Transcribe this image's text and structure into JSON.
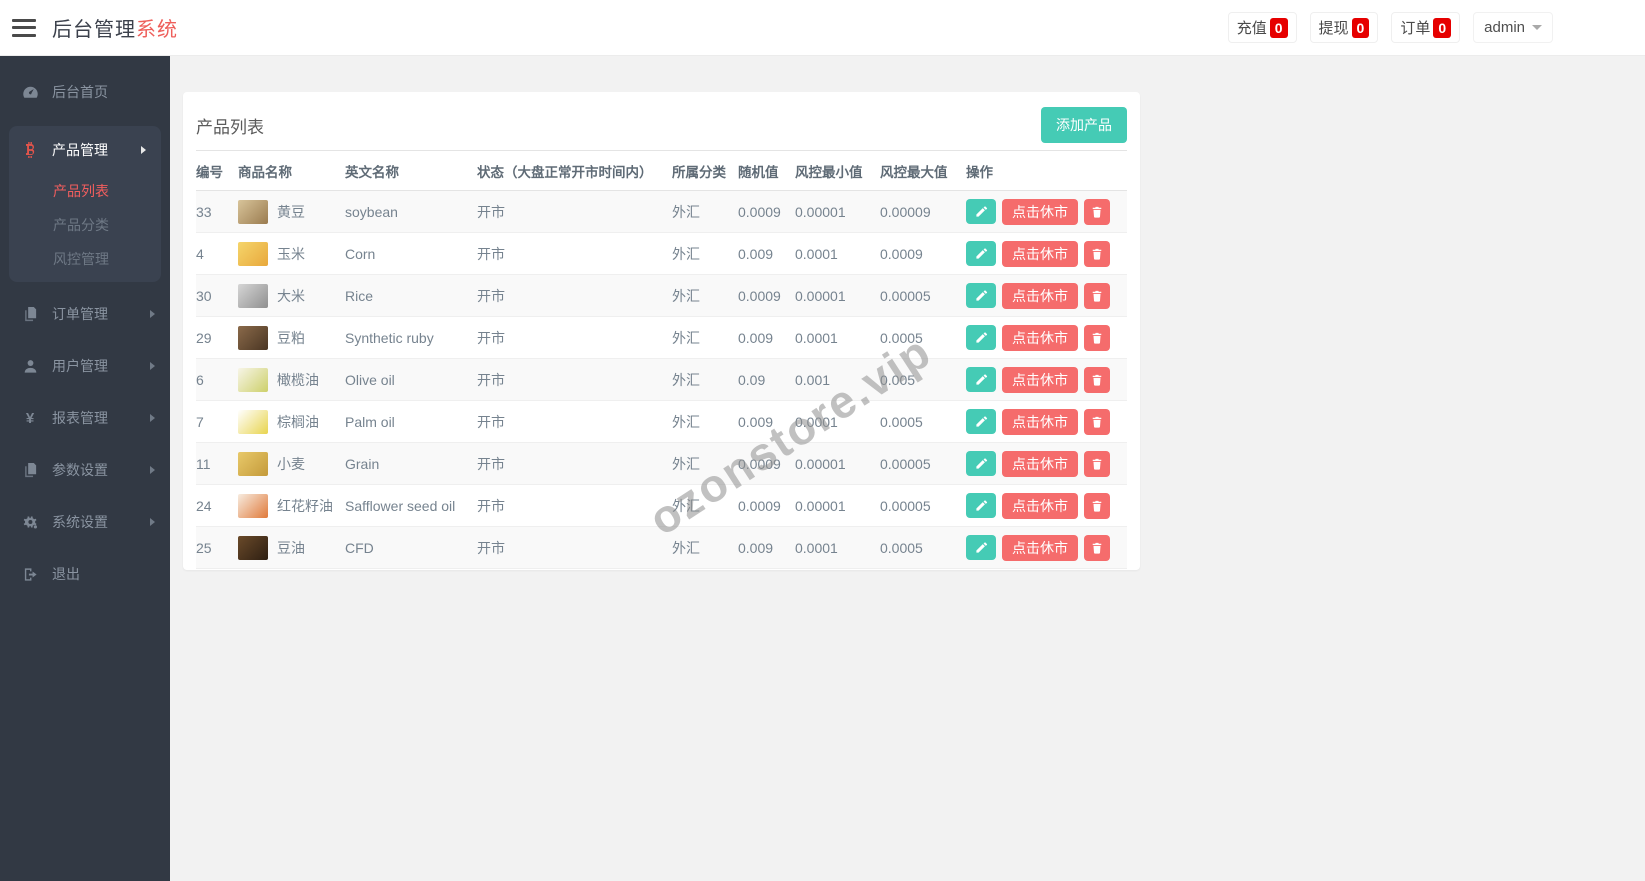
{
  "brand": {
    "prefix": "后台管理",
    "suffix": "系统"
  },
  "topbar": {
    "stats": [
      {
        "label": "充值",
        "count": "0"
      },
      {
        "label": "提现",
        "count": "0"
      },
      {
        "label": "订单",
        "count": "0"
      }
    ],
    "user": "admin"
  },
  "sidebar": {
    "items": [
      {
        "label": "后台首页",
        "icon": "dashboard-icon"
      },
      {
        "label": "产品管理",
        "icon": "bitcoin-icon",
        "expanded": true,
        "children": [
          "产品列表",
          "产品分类",
          "风控管理"
        ],
        "active_child": "产品列表"
      },
      {
        "label": "订单管理",
        "icon": "orders-icon"
      },
      {
        "label": "用户管理",
        "icon": "user-icon"
      },
      {
        "label": "报表管理",
        "icon": "yen-icon"
      },
      {
        "label": "参数设置",
        "icon": "params-icon"
      },
      {
        "label": "系统设置",
        "icon": "gear-icon"
      },
      {
        "label": "退出",
        "icon": "logout-icon"
      }
    ]
  },
  "main": {
    "card_title": "产品列表",
    "add_button": "添加产品",
    "watermark": "ozonstore.vip",
    "table": {
      "headers": [
        "编号",
        "商品名称",
        "英文名称",
        "状态（大盘正常开市时间内）",
        "所属分类",
        "随机值",
        "风控最小值",
        "风控最大值",
        "操作"
      ],
      "row_action_label": "点击休市",
      "rows": [
        {
          "id": "33",
          "name": "黄豆",
          "en": "soybean",
          "status": "开市",
          "category": "外汇",
          "random": "0.0009",
          "risk_min": "0.00001",
          "risk_max": "0.00009",
          "thumb": [
            "#d8c49a",
            "#9a7b4f"
          ]
        },
        {
          "id": "4",
          "name": "玉米",
          "en": "Corn",
          "status": "开市",
          "category": "外汇",
          "random": "0.009",
          "risk_min": "0.0001",
          "risk_max": "0.0009",
          "thumb": [
            "#f5d56b",
            "#e8a83c"
          ]
        },
        {
          "id": "30",
          "name": "大米",
          "en": "Rice",
          "status": "开市",
          "category": "外汇",
          "random": "0.0009",
          "risk_min": "0.00001",
          "risk_max": "0.00005",
          "thumb": [
            "#d6d6d6",
            "#8f8f8f"
          ]
        },
        {
          "id": "29",
          "name": "豆粕",
          "en": "Synthetic ruby",
          "status": "开市",
          "category": "外汇",
          "random": "0.009",
          "risk_min": "0.0001",
          "risk_max": "0.0005",
          "thumb": [
            "#8a6a4a",
            "#4a3523"
          ]
        },
        {
          "id": "6",
          "name": "橄榄油",
          "en": "Olive oil",
          "status": "开市",
          "category": "外汇",
          "random": "0.09",
          "risk_min": "0.001",
          "risk_max": "0.005",
          "thumb": [
            "#f7f5e8",
            "#cdd06a"
          ]
        },
        {
          "id": "7",
          "name": "棕榈油",
          "en": "Palm oil",
          "status": "开市",
          "category": "外汇",
          "random": "0.009",
          "risk_min": "0.0001",
          "risk_max": "0.0005",
          "thumb": [
            "#ffffff",
            "#e8d44e"
          ]
        },
        {
          "id": "11",
          "name": "小麦",
          "en": "Grain",
          "status": "开市",
          "category": "外汇",
          "random": "0.0009",
          "risk_min": "0.00001",
          "risk_max": "0.00005",
          "thumb": [
            "#e8c96a",
            "#c49a3a"
          ]
        },
        {
          "id": "24",
          "name": "红花籽油",
          "en": "Safflower seed oil",
          "status": "开市",
          "category": "外汇",
          "random": "0.0009",
          "risk_min": "0.00001",
          "risk_max": "0.00005",
          "thumb": [
            "#f7ece0",
            "#e07a3a"
          ]
        },
        {
          "id": "25",
          "name": "豆油",
          "en": "CFD",
          "status": "开市",
          "category": "外汇",
          "random": "0.009",
          "risk_min": "0.0001",
          "risk_max": "0.0005",
          "thumb": [
            "#6a4a2a",
            "#2e1f12"
          ]
        }
      ]
    }
  },
  "colors": {
    "accent_teal": "#45cbb5",
    "accent_red": "#f56c6c",
    "badge_red": "#e60000",
    "brand_red": "#ee5f5b",
    "sidebar_bg": "#323944",
    "sidebar_panel_bg": "#3a4250",
    "active_link": "#f25e5e"
  }
}
